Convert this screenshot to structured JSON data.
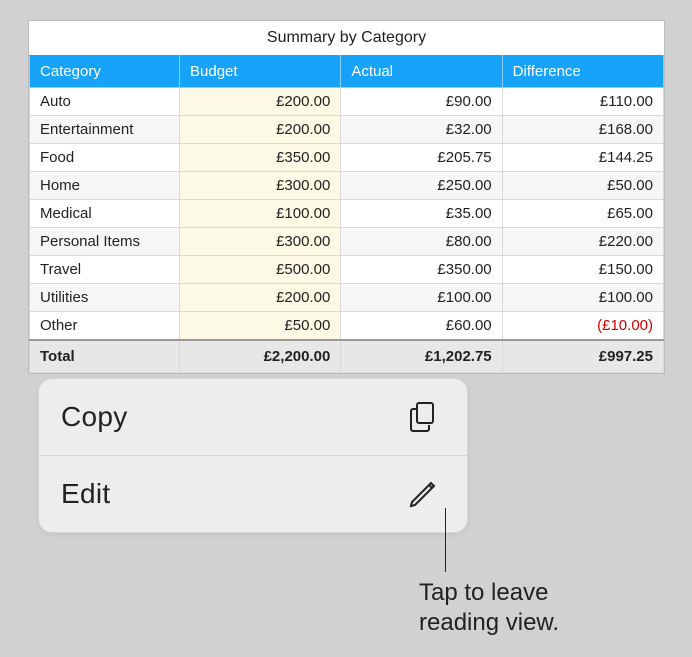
{
  "sheet": {
    "title": "Summary by Category",
    "headers": [
      "Category",
      "Budget",
      "Actual",
      "Difference"
    ],
    "rows": [
      {
        "category": "Auto",
        "budget": "£200.00",
        "actual": "£90.00",
        "diff": "£110.00",
        "neg": false
      },
      {
        "category": "Entertainment",
        "budget": "£200.00",
        "actual": "£32.00",
        "diff": "£168.00",
        "neg": false
      },
      {
        "category": "Food",
        "budget": "£350.00",
        "actual": "£205.75",
        "diff": "£144.25",
        "neg": false
      },
      {
        "category": "Home",
        "budget": "£300.00",
        "actual": "£250.00",
        "diff": "£50.00",
        "neg": false
      },
      {
        "category": "Medical",
        "budget": "£100.00",
        "actual": "£35.00",
        "diff": "£65.00",
        "neg": false
      },
      {
        "category": "Personal Items",
        "budget": "£300.00",
        "actual": "£80.00",
        "diff": "£220.00",
        "neg": false
      },
      {
        "category": "Travel",
        "budget": "£500.00",
        "actual": "£350.00",
        "diff": "£150.00",
        "neg": false
      },
      {
        "category": "Utilities",
        "budget": "£200.00",
        "actual": "£100.00",
        "diff": "£100.00",
        "neg": false
      },
      {
        "category": "Other",
        "budget": "£50.00",
        "actual": "£60.00",
        "diff": "(£10.00)",
        "neg": true
      }
    ],
    "total": {
      "label": "Total",
      "budget": "£2,200.00",
      "actual": "£1,202.75",
      "diff": "£997.25"
    }
  },
  "menu": {
    "copy_label": "Copy",
    "edit_label": "Edit"
  },
  "callout": {
    "line1": "Tap to leave",
    "line2": "reading view."
  },
  "chart_data": {
    "type": "table",
    "title": "Summary by Category",
    "columns": [
      "Category",
      "Budget",
      "Actual",
      "Difference"
    ],
    "currency": "GBP",
    "rows": [
      [
        "Auto",
        200.0,
        90.0,
        110.0
      ],
      [
        "Entertainment",
        200.0,
        32.0,
        168.0
      ],
      [
        "Food",
        350.0,
        205.75,
        144.25
      ],
      [
        "Home",
        300.0,
        250.0,
        50.0
      ],
      [
        "Medical",
        100.0,
        35.0,
        65.0
      ],
      [
        "Personal Items",
        300.0,
        80.0,
        220.0
      ],
      [
        "Travel",
        500.0,
        350.0,
        150.0
      ],
      [
        "Utilities",
        200.0,
        100.0,
        100.0
      ],
      [
        "Other",
        50.0,
        60.0,
        -10.0
      ]
    ],
    "total": [
      "Total",
      2200.0,
      1202.75,
      997.25
    ]
  }
}
